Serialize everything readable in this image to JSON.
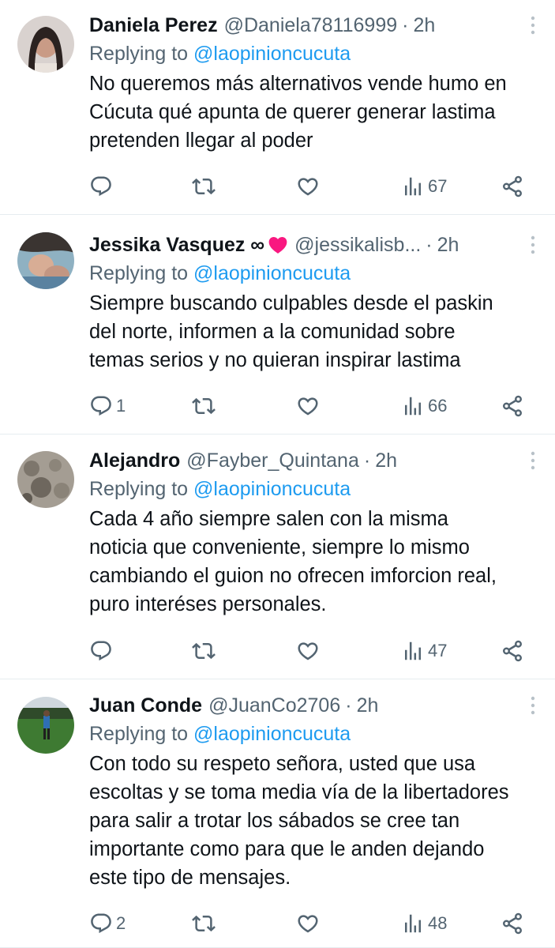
{
  "colors": {
    "link": "#1d9bf0",
    "secondary_text": "#536471",
    "primary_text": "#0f1419",
    "heart_badge": "#f91880"
  },
  "replying_label": "Replying to",
  "tweets": [
    {
      "name": "Daniela Perez",
      "handle": "@Daniela78116999",
      "separator": "·",
      "time": "2h",
      "replying_to": "@laopinioncucuta",
      "text_lines": [
        "No queremos más alternativos vende humo en",
        "Cúcuta qué apunta de querer generar lastima",
        "pretenden llegar al poder"
      ],
      "replies": "",
      "views": "67",
      "avatar_icon": "avatar-photo-woman"
    },
    {
      "name": "Jessika Vasquez ∞",
      "name_badge_icon": "red-heart-icon",
      "handle": "@jessikalisb...",
      "separator": "·",
      "time": "2h",
      "replying_to": "@laopinioncucuta",
      "text_lines": [
        "Siempre buscando culpables desde el paskin",
        "del norte, informen a la comunidad sobre",
        "temas serios y no quieran inspirar lastima"
      ],
      "replies": "1",
      "views": "66",
      "avatar_icon": "avatar-photo-child"
    },
    {
      "name": "Alejandro",
      "handle": "@Fayber_Quintana",
      "separator": "·",
      "time": "2h",
      "replying_to": "@laopinioncucuta",
      "text_lines": [
        "Cada 4 año siempre salen con la misma",
        "noticia que conveniente, siempre lo mismo",
        "cambiando el guion no ofrecen imforcion real,",
        "puro interéses personales."
      ],
      "replies": "",
      "views": "47",
      "avatar_icon": "avatar-photo-rocks"
    },
    {
      "name": "Juan Conde",
      "handle": "@JuanCo2706",
      "separator": "·",
      "time": "2h",
      "replying_to": "@laopinioncucuta",
      "text_lines": [
        "Con todo su respeto señora, usted que usa",
        "escoltas y se toma media vía de la libertadores",
        "para salir a trotar los sábados se cree tan",
        "importante como para que le anden dejando",
        "este tipo de mensajes."
      ],
      "replies": "2",
      "views": "48",
      "avatar_icon": "avatar-photo-soccer-field"
    }
  ]
}
